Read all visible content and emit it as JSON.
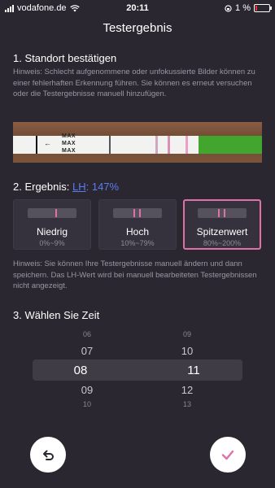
{
  "status": {
    "carrier": "vodafone.de",
    "time": "20:11",
    "battery": "1 %"
  },
  "header": {
    "title": "Testergebnis"
  },
  "section1": {
    "heading": "1. Standort bestätigen",
    "hint": "Hinweis: Schlecht aufgenommene oder unfokussierte Bilder können zu einer fehlerhaften Erkennung führen. Sie können es erneut versuchen oder die Testergebnisse manuell hinzufügen."
  },
  "strip": {
    "labels": [
      "MAX",
      "MAX",
      "MAX"
    ]
  },
  "section2": {
    "prefix": "2. Ergebnis:",
    "lh": "LH",
    "value": ": 147%"
  },
  "cards": [
    {
      "name": "Niedrig",
      "range": "0%~9%"
    },
    {
      "name": "Hoch",
      "range": "10%~79%"
    },
    {
      "name": "Spitzenwert",
      "range": "80%~200%"
    }
  ],
  "hint2": "Hinweis: Sie können Ihre Testergebnisse manuell ändern und dann speichern. Das LH-Wert wird bei manuell bearbeiteten Testergebnissen nicht angezeigt.",
  "section3": {
    "heading": "3. Wählen Sie Zeit"
  },
  "picker": {
    "hours": [
      "06",
      "07",
      "08",
      "09",
      "10"
    ],
    "minutes": [
      "09",
      "10",
      "11",
      "12",
      "13"
    ]
  },
  "colors": {
    "accent": "#e070a8",
    "link": "#5b7cf0",
    "background": "#2b2730"
  },
  "icons": {
    "back": "undo-arrow-icon",
    "confirm": "checkmark-icon"
  }
}
